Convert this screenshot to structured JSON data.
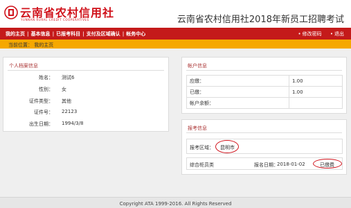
{
  "colors": {
    "brand": "#d0121b",
    "nav": "#c41a1a",
    "location_bar": "#f5a800"
  },
  "header": {
    "logo_icon": "bank-logo-icon",
    "logo_title": "云南省农村信用社",
    "logo_subtitle": "YUNNAN RURAL CREDIT COOPERATIVES",
    "title": "云南省农村信用社2018年新员工招聘考试"
  },
  "nav": {
    "items": [
      {
        "label": "我的主页"
      },
      {
        "label": "基本信息"
      },
      {
        "label": "已报考科目"
      },
      {
        "label": "支付及区域确认"
      },
      {
        "label": "帐务中心"
      }
    ],
    "sep": "|",
    "right_dot": "•",
    "change_password": "修改密码",
    "logout": "退出"
  },
  "location": {
    "text": "当前位置： 我的主页"
  },
  "personal": {
    "title": "个人档案信息",
    "rows": [
      {
        "label": "姓名：",
        "value": "测试6"
      },
      {
        "label": "性别：",
        "value": "女"
      },
      {
        "label": "证件类型：",
        "value": "其他"
      },
      {
        "label": "证件号：",
        "value": "22123"
      },
      {
        "label": "出生日期：",
        "value": "1994/3/8"
      }
    ]
  },
  "account": {
    "title": "帐户信息",
    "rows": [
      {
        "label": "应缴：",
        "value": "1.00"
      },
      {
        "label": "已缴：",
        "value": "1.00"
      },
      {
        "label": "帐户余额：",
        "value": ""
      }
    ]
  },
  "registration": {
    "title": "报考信息",
    "region_label": "报考区域：",
    "region_value": "昆明市",
    "position": "综合柜员类",
    "date_label": "报名日期：",
    "date_value": "2018-01-02",
    "status": "已缴费"
  },
  "footer": {
    "text": "Copyright ATA 1999-2016. All Rights Reserved"
  }
}
